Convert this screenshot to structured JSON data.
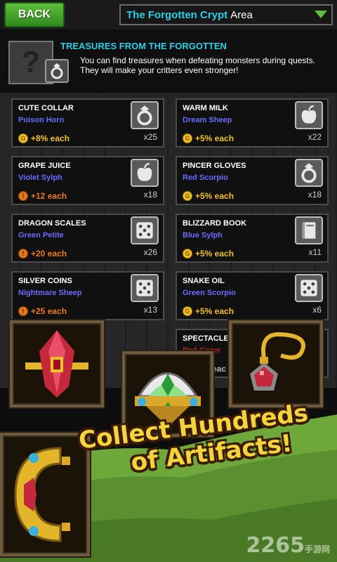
{
  "topbar": {
    "back_label": "BACK",
    "area_name": "The Forgotten Crypt",
    "area_suffix": "Area"
  },
  "header": {
    "title": "TREASURES FROM THE FORGOTTEN",
    "description": "You can find treasures when defeating monsters during quests. They will make your critters even stronger!",
    "unknown_glyph": "?"
  },
  "items": [
    {
      "name": "CUTE COLLAR",
      "source": "Poison Horn",
      "bonus": "+8% each",
      "bonus_type": "gold",
      "count": "x25",
      "icon": "ring-icon"
    },
    {
      "name": "WARM MILK",
      "source": "Dream Sheep",
      "bonus": "+5% each",
      "bonus_type": "gold",
      "count": "x22",
      "icon": "apple-icon"
    },
    {
      "name": "GRAPE JUICE",
      "source": "Violet Sylph",
      "bonus": "+12 each",
      "bonus_type": "orange",
      "count": "x18",
      "icon": "apple-icon"
    },
    {
      "name": "PINCER GLOVES",
      "source": "Red Scorpio",
      "bonus": "+5% each",
      "bonus_type": "gold",
      "count": "x18",
      "icon": "ring-icon"
    },
    {
      "name": "DRAGON SCALES",
      "source": "Green Petite",
      "bonus": "+20 each",
      "bonus_type": "orange",
      "count": "x26",
      "icon": "dice-icon"
    },
    {
      "name": "BLIZZARD BOOK",
      "source": "Blue Sylph",
      "bonus": "+5% each",
      "bonus_type": "gold",
      "count": "x11",
      "icon": "book-icon"
    },
    {
      "name": "SILVER COINS",
      "source": "Nightmare Sheep",
      "bonus": "+25 each",
      "bonus_type": "orange",
      "count": "x13",
      "icon": "dice-icon"
    },
    {
      "name": "SNAKE OIL",
      "source": "Green Scorpio",
      "bonus": "+5% each",
      "bonus_type": "gold",
      "count": "x6",
      "icon": "dice-icon"
    }
  ],
  "partial_item": {
    "name": "SPECTACLES",
    "source": "Red Gazer",
    "bonus_fragment": "eac"
  },
  "coin_glyphs": {
    "gold": "G",
    "orange": "!"
  },
  "promo": {
    "line1": "Collect Hundreds",
    "line2": "of Artifacts!"
  },
  "watermark": {
    "main": "2265",
    "sub": "手游网"
  },
  "colors": {
    "accent_cyan": "#2bd0e6",
    "source_purple": "#6b6bff",
    "gold": "#f1c02a",
    "orange": "#f07a20",
    "back_green": "#3f9e27"
  }
}
